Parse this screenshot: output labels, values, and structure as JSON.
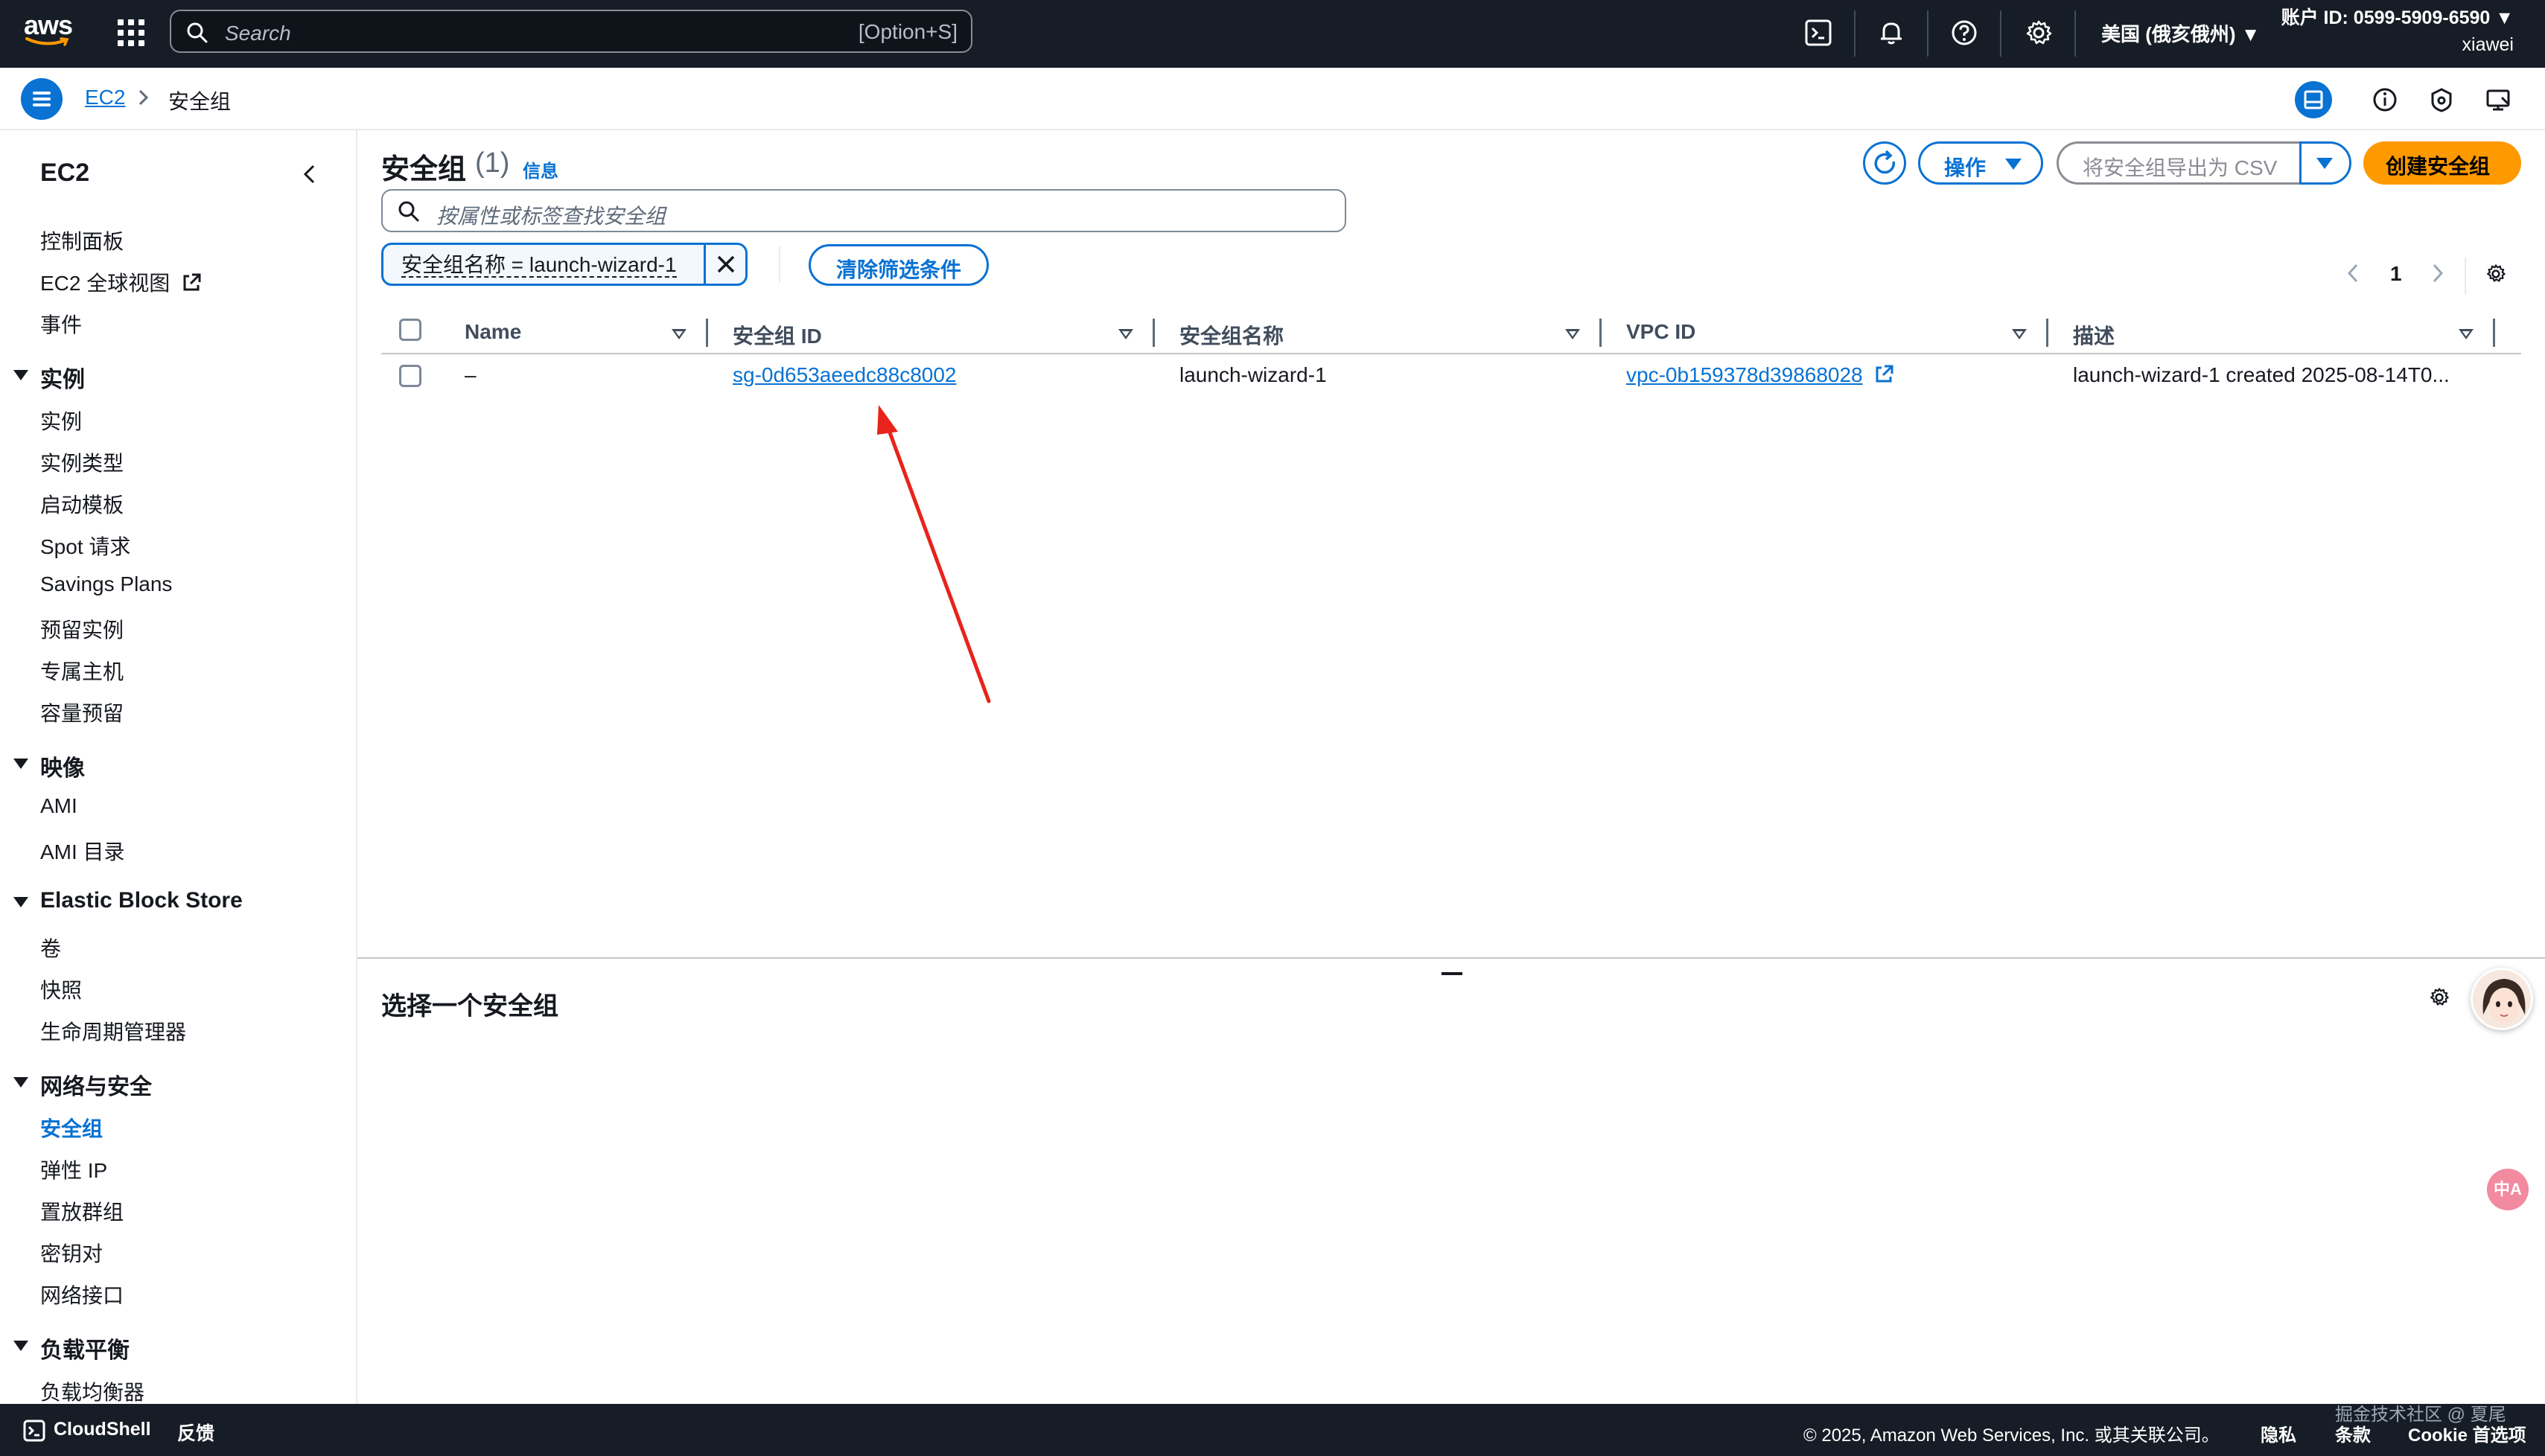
{
  "topnav": {
    "logo_text": "aws",
    "search_placeholder": "Search",
    "search_shortcut": "[Option+S]",
    "region": "美国 (俄亥俄州) ▼",
    "account_id": "账户 ID: 0599-5909-6590 ▼",
    "user": "xiawei"
  },
  "breadcrumb": {
    "root": "EC2",
    "current": "安全组"
  },
  "sidebar": {
    "title": "EC2",
    "top_items": [
      "控制面板",
      "EC2 全球视图",
      "事件"
    ],
    "sections": [
      {
        "title": "实例",
        "items": [
          "实例",
          "实例类型",
          "启动模板",
          "Spot 请求",
          "Savings Plans",
          "预留实例",
          "专属主机",
          "容量预留"
        ]
      },
      {
        "title": "映像",
        "items": [
          "AMI",
          "AMI 目录"
        ]
      },
      {
        "title": "Elastic Block Store",
        "items": [
          "卷",
          "快照",
          "生命周期管理器"
        ]
      },
      {
        "title": "网络与安全",
        "items": [
          "安全组",
          "弹性 IP",
          "置放群组",
          "密钥对",
          "网络接口"
        ]
      },
      {
        "title": "负载平衡",
        "items": [
          "负载均衡器"
        ]
      }
    ],
    "active_item": "安全组"
  },
  "main": {
    "title": "安全组",
    "count": "(1)",
    "info": "信息",
    "actions_label": "操作",
    "export_label": "将安全组导出为 CSV",
    "create_label": "创建安全组",
    "filter_placeholder": "按属性或标签查找安全组",
    "token_label": "安全组名称 = launch-wizard-1",
    "clear_label": "清除筛选条件",
    "page_number": "1"
  },
  "table": {
    "columns": [
      "Name",
      "安全组 ID",
      "安全组名称",
      "VPC ID",
      "描述"
    ],
    "rows": [
      {
        "name": "–",
        "sg_id": "sg-0d653aeedc88c8002",
        "sg_name": "launch-wizard-1",
        "vpc_id": "vpc-0b159378d39868028",
        "description": "launch-wizard-1 created 2025-08-14T0..."
      }
    ]
  },
  "split_panel": {
    "title": "选择一个安全组"
  },
  "translate_bubble": "中A",
  "footer": {
    "cloudshell": "CloudShell",
    "feedback": "反馈",
    "copyright": "© 2025, Amazon Web Services, Inc. 或其关联公司。",
    "privacy": "隐私",
    "terms": "条款",
    "cookie": "Cookie 首选项",
    "watermark": "掘金技术社区 @ 夏尾"
  },
  "colors": {
    "nav_bg": "#161d26",
    "link": "#0972d3",
    "primary_button": "#ff9900",
    "annotation_arrow": "#e8231c"
  }
}
